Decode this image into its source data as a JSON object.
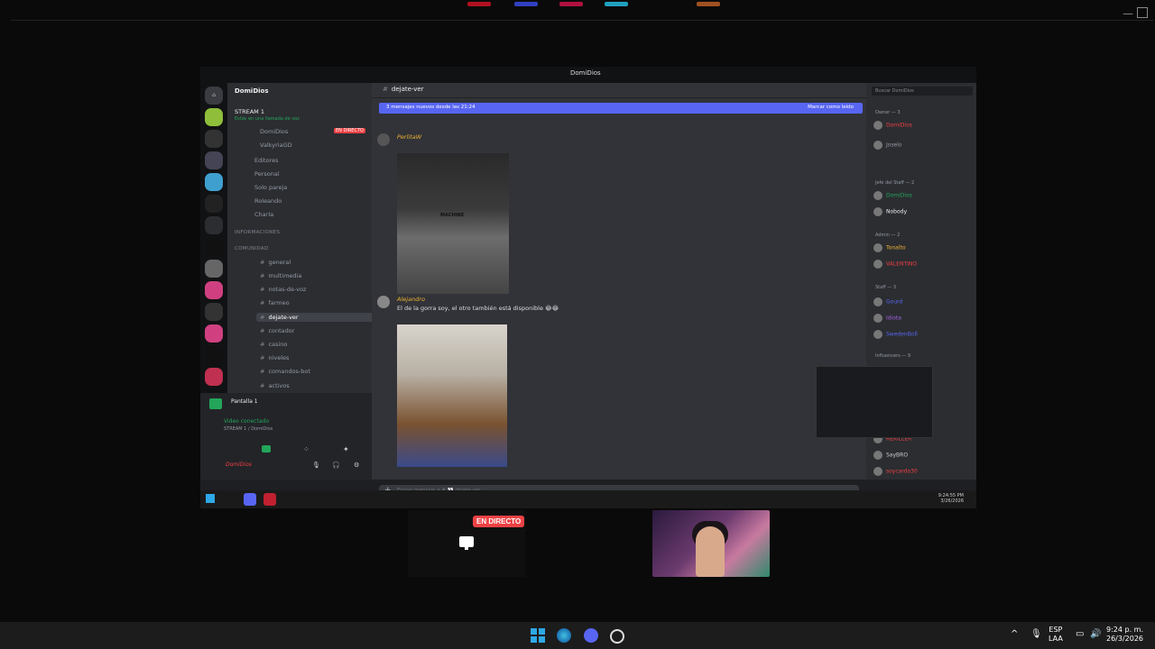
{
  "inner_window": {
    "title": "DomiDios"
  },
  "server": {
    "name": "DomiDios",
    "stream_channel": "STREAM 1",
    "stream_sub": "Estás en una llamada de voz",
    "live_label": "EN DIRECTO",
    "voice_users": [
      "DomiDios",
      "ValkyriaGD"
    ],
    "side_channels": [
      "Editores",
      "Personal",
      "Solo pareja",
      "Roleando",
      "Charla"
    ],
    "categories": {
      "info": "INFORMACIONES",
      "community": "COMUNIDAD"
    },
    "channels": [
      "general",
      "multimedia",
      "notas-de-voz",
      "farmeo",
      "dejate-ver",
      "contador",
      "casino",
      "niveles",
      "comandos-bot",
      "activos"
    ],
    "active_channel": "dejate-ver"
  },
  "main": {
    "header_channel": "dejate-ver",
    "new_messages": "3 mensajes nuevos desde las 21:24",
    "mark_read": "Marcar como leído",
    "msg1_author": "PerlitaW",
    "img1_label": "MACHINE",
    "msg2_author": "Alejandro",
    "msg2_text": "El de la gorra soy, el otro también está disponible 😂😂",
    "input_placeholder": "Enviar mensaje a # 👀 dejate-ver"
  },
  "members": {
    "search_placeholder": "Buscar DomiDios",
    "groups": [
      "Owner — 3",
      "Jefe del Staff — 2",
      "Admin — 2",
      "Staff — 3",
      "Influencers — 9"
    ],
    "names": [
      "DomiDios",
      "Joselo",
      "Nobody",
      "Tonalto",
      "VALENTINO",
      "Gourd",
      "Idiota",
      "SwedenBoll",
      "REKILLER",
      "SayBRO",
      "soycardo30"
    ]
  },
  "voice_panel": {
    "screen_label": "Pantalla 1",
    "connected": "Video conectado",
    "sub": "STREAM 1 / DomiDios",
    "user": "DomiDios"
  },
  "inner_taskbar": {
    "time": "9:24:55 PM",
    "date": "3/26/2026"
  },
  "tiles": {
    "live_badge": "EN DIRECTO"
  },
  "taskbar": {
    "lang_top": "ESP",
    "lang_bottom": "LAA",
    "time": "9:24 p. m.",
    "date": "26/3/2026"
  },
  "colors": {
    "accent": "#5865f2",
    "live": "#ed4245"
  }
}
